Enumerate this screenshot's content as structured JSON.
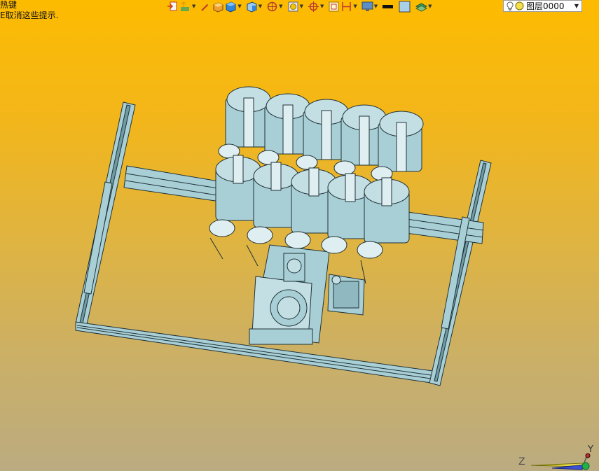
{
  "hint": {
    "line1": "热键",
    "line2": "E取消这些提示."
  },
  "toolbar": {
    "buttons": [
      {
        "icon": "import-icon",
        "dropdown": false
      },
      {
        "icon": "move-icon",
        "dropdown": true
      },
      {
        "icon": "wand-icon",
        "dropdown": false
      },
      {
        "icon": "box-icon",
        "dropdown": false
      },
      {
        "icon": "cube-icon",
        "dropdown": true
      },
      {
        "icon": "cube-view-icon",
        "dropdown": true
      },
      {
        "icon": "rotate-icon",
        "dropdown": true
      },
      {
        "icon": "render-icon",
        "dropdown": true
      },
      {
        "icon": "snap-icon",
        "dropdown": true
      },
      {
        "icon": "sketch-icon",
        "dropdown": false
      },
      {
        "icon": "dimension-icon",
        "dropdown": true
      },
      {
        "icon": "display-icon",
        "dropdown": true
      },
      {
        "icon": "line-color-icon",
        "dropdown": false
      },
      {
        "icon": "face-color-icon",
        "dropdown": false
      },
      {
        "icon": "layers-icon",
        "dropdown": true
      }
    ]
  },
  "layer": {
    "name": "图层0000",
    "visible_icon": "lightbulb-icon",
    "state_icon": "light-state-icon"
  },
  "axes": {
    "z_label": "Z",
    "y_label": "Y"
  },
  "colors": {
    "background_top": "#fdbb00",
    "background_bottom": "#bbab80",
    "model_fill": "#a9cfd6",
    "model_edge": "#1f3238"
  }
}
